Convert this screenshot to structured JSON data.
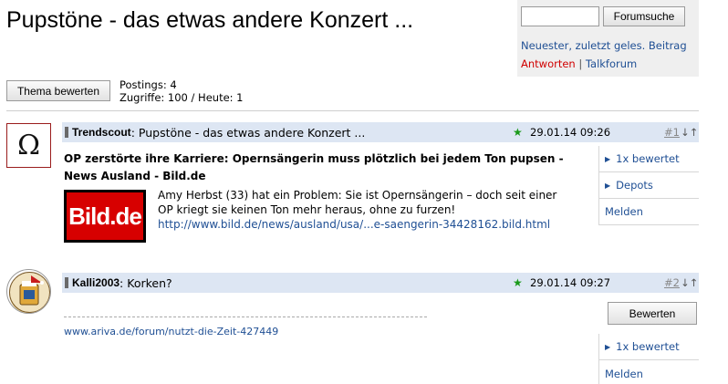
{
  "page": {
    "title": "Pupstöne - das etwas andere Konzert ..."
  },
  "sidebar": {
    "search_placeholder": "",
    "search_button": "Forumsuche",
    "link_newest": "Neuester, zuletzt geles. Beitrag",
    "link_answer": "Antworten",
    "separator": "|",
    "link_talkforum": "Talkforum"
  },
  "thread": {
    "rate_button": "Thema bewerten",
    "postings": "Postings: 4",
    "views": "Zugriffe: 100 / Heute: 1"
  },
  "posts": [
    {
      "avatar_glyph": "Ω",
      "author": "Trendscout",
      "colon": ":",
      "subject": "Pupstöne - das etwas andere Konzert ...",
      "star": "★",
      "date": "29.01.14 09:26",
      "number": "#1",
      "arrows": "↓↑",
      "article_title": "OP zerstörte ihre Karriere: Opernsängerin muss plötzlich bei jedem Ton pupsen - News Ausland - Bild.de",
      "logo_text": "Bild.de",
      "article_text": "Amy Herbst (33) hat ein Problem: Sie ist Opernsängerin – doch seit einer OP kriegt sie keinen Ton mehr heraus, ohne zu furzen!",
      "article_link": "http://www.bild.de/news/ausland/usa/...e-saengerin-34428162.bild.html",
      "actions": [
        {
          "label": "1x bewertet",
          "arrow": "▶"
        },
        {
          "label": "Depots",
          "arrow": "▶"
        },
        {
          "label": "Melden",
          "arrow": ""
        }
      ]
    },
    {
      "author": "Kalli2003",
      "colon": ":",
      "subject": "Korken?",
      "star": "★",
      "date": "29.01.14 09:27",
      "number": "#2",
      "arrows": "↓↑",
      "signature_link": "www.ariva.de/forum/nutzt-die-Zeit-427449",
      "rate_button": "Bewerten",
      "actions": [
        {
          "label": "1x bewertet",
          "arrow": "▶"
        },
        {
          "label": "Melden",
          "arrow": ""
        }
      ]
    }
  ]
}
